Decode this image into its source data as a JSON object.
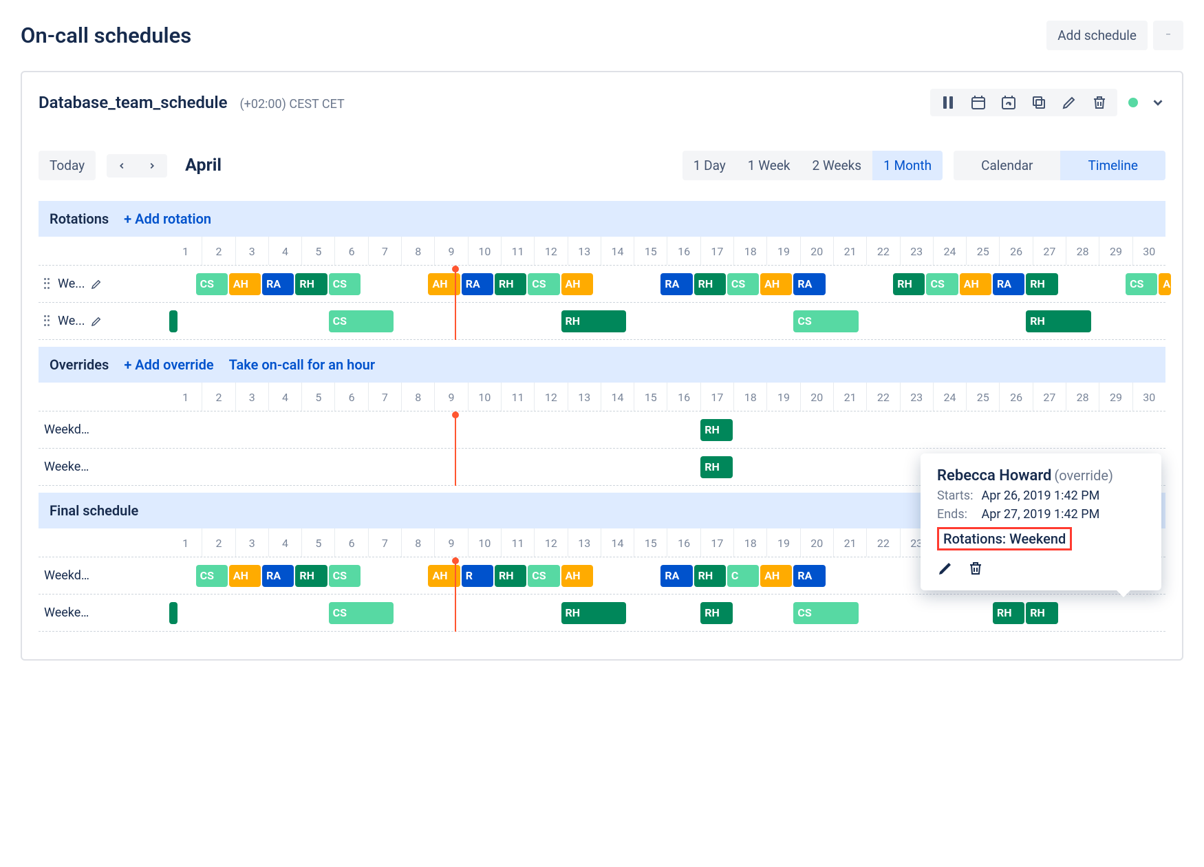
{
  "page_title": "On-call schedules",
  "add_schedule_label": "Add schedule",
  "schedule_name": "Database_team_schedule",
  "timezone": "(+02:00) CEST CET",
  "nav": {
    "today": "Today",
    "month": "April"
  },
  "ranges": {
    "day": "1 Day",
    "week": "1 Week",
    "two_weeks": "2 Weeks",
    "month": "1 Month"
  },
  "view": {
    "calendar": "Calendar",
    "timeline": "Timeline"
  },
  "days": [
    "1",
    "2",
    "3",
    "4",
    "5",
    "6",
    "7",
    "8",
    "9",
    "10",
    "11",
    "12",
    "13",
    "14",
    "15",
    "16",
    "17",
    "18",
    "19",
    "20",
    "21",
    "22",
    "23",
    "24",
    "25",
    "26",
    "27",
    "28",
    "29",
    "30"
  ],
  "now_day_index": 8.6,
  "sections": {
    "rotations": {
      "title": "Rotations",
      "add": "+ Add rotation",
      "rows": [
        {
          "label": "We...",
          "draggable": true,
          "editable": true,
          "blocks": [
            {
              "start": 0.8,
              "span": 1,
              "label": "CS",
              "color": "c-lime"
            },
            {
              "start": 1.8,
              "span": 1,
              "label": "AH",
              "color": "c-orange"
            },
            {
              "start": 2.8,
              "span": 1,
              "label": "RA",
              "color": "c-blue"
            },
            {
              "start": 3.8,
              "span": 1,
              "label": "RH",
              "color": "c-teal"
            },
            {
              "start": 4.8,
              "span": 1,
              "label": "CS",
              "color": "c-lime"
            },
            {
              "start": 7.8,
              "span": 1,
              "label": "AH",
              "color": "c-orange"
            },
            {
              "start": 8.8,
              "span": 1,
              "label": "RA",
              "color": "c-blue"
            },
            {
              "start": 9.8,
              "span": 1,
              "label": "RH",
              "color": "c-teal"
            },
            {
              "start": 10.8,
              "span": 1,
              "label": "CS",
              "color": "c-lime"
            },
            {
              "start": 11.8,
              "span": 1,
              "label": "AH",
              "color": "c-orange"
            },
            {
              "start": 14.8,
              "span": 1,
              "label": "RA",
              "color": "c-blue"
            },
            {
              "start": 15.8,
              "span": 1,
              "label": "RH",
              "color": "c-teal"
            },
            {
              "start": 16.8,
              "span": 1,
              "label": "CS",
              "color": "c-lime"
            },
            {
              "start": 17.8,
              "span": 1,
              "label": "AH",
              "color": "c-orange"
            },
            {
              "start": 18.8,
              "span": 1,
              "label": "RA",
              "color": "c-blue"
            },
            {
              "start": 21.8,
              "span": 1,
              "label": "RH",
              "color": "c-teal"
            },
            {
              "start": 22.8,
              "span": 1,
              "label": "CS",
              "color": "c-lime"
            },
            {
              "start": 23.8,
              "span": 1,
              "label": "AH",
              "color": "c-orange"
            },
            {
              "start": 24.8,
              "span": 1,
              "label": "RA",
              "color": "c-blue"
            },
            {
              "start": 25.8,
              "span": 1,
              "label": "RH",
              "color": "c-teal"
            },
            {
              "start": 28.8,
              "span": 1,
              "label": "CS",
              "color": "c-lime"
            },
            {
              "start": 29.8,
              "span": 0.4,
              "label": "A",
              "color": "c-orange"
            }
          ]
        },
        {
          "label": "We...",
          "draggable": true,
          "editable": true,
          "blocks": [
            {
              "start": 0,
              "span": 0.3,
              "label": "",
              "color": "c-teal"
            },
            {
              "start": 4.8,
              "span": 2,
              "label": "CS",
              "color": "c-lime"
            },
            {
              "start": 11.8,
              "span": 2,
              "label": "RH",
              "color": "c-teal"
            },
            {
              "start": 18.8,
              "span": 2,
              "label": "CS",
              "color": "c-lime"
            },
            {
              "start": 25.8,
              "span": 2,
              "label": "RH",
              "color": "c-teal"
            }
          ]
        }
      ]
    },
    "overrides": {
      "title": "Overrides",
      "add": "+ Add override",
      "take": "Take on-call for an hour",
      "rows": [
        {
          "label": "Weekday's...",
          "blocks": [
            {
              "start": 16,
              "span": 1,
              "label": "RH",
              "color": "c-teal"
            }
          ]
        },
        {
          "label": "Weekend'...",
          "blocks": [
            {
              "start": 16,
              "span": 1,
              "label": "RH",
              "color": "c-teal"
            }
          ]
        }
      ]
    },
    "final": {
      "title": "Final schedule",
      "rows": [
        {
          "label": "Weekday's...",
          "blocks": [
            {
              "start": 0.8,
              "span": 1,
              "label": "CS",
              "color": "c-lime",
              "shadow": true
            },
            {
              "start": 1.8,
              "span": 1,
              "label": "AH",
              "color": "c-orange",
              "shadow": true
            },
            {
              "start": 2.8,
              "span": 1,
              "label": "RA",
              "color": "c-blue",
              "shadow": true
            },
            {
              "start": 3.8,
              "span": 1,
              "label": "RH",
              "color": "c-teal",
              "shadow": true
            },
            {
              "start": 4.8,
              "span": 1,
              "label": "CS",
              "color": "c-lime",
              "shadow": true
            },
            {
              "start": 7.8,
              "span": 1,
              "label": "AH",
              "color": "c-orange",
              "shadow": true
            },
            {
              "start": 8.8,
              "span": 1,
              "label": "R",
              "color": "c-blue"
            },
            {
              "start": 9.8,
              "span": 1,
              "label": "RH",
              "color": "c-teal"
            },
            {
              "start": 10.8,
              "span": 1,
              "label": "CS",
              "color": "c-lime"
            },
            {
              "start": 11.8,
              "span": 1,
              "label": "AH",
              "color": "c-orange"
            },
            {
              "start": 14.8,
              "span": 1,
              "label": "RA",
              "color": "c-blue"
            },
            {
              "start": 15.8,
              "span": 1,
              "label": "RH",
              "color": "c-teal"
            },
            {
              "start": 16.8,
              "span": 1,
              "label": "C",
              "color": "c-lime"
            },
            {
              "start": 17.8,
              "span": 1,
              "label": "AH",
              "color": "c-orange"
            },
            {
              "start": 18.8,
              "span": 1,
              "label": "RA",
              "color": "c-blue"
            }
          ]
        },
        {
          "label": "Weekend'...",
          "blocks": [
            {
              "start": 0,
              "span": 0.3,
              "label": "",
              "color": "c-teal"
            },
            {
              "start": 4.8,
              "span": 2,
              "label": "CS",
              "color": "c-lime",
              "shadow": true
            },
            {
              "start": 11.8,
              "span": 2,
              "label": "RH",
              "color": "c-teal"
            },
            {
              "start": 16,
              "span": 1,
              "label": "RH",
              "color": "c-teal"
            },
            {
              "start": 18.8,
              "span": 2,
              "label": "CS",
              "color": "c-lime"
            },
            {
              "start": 24.8,
              "span": 1,
              "label": "RH",
              "color": "c-teal"
            },
            {
              "start": 25.8,
              "span": 1,
              "label": "RH",
              "color": "c-teal"
            }
          ]
        }
      ]
    }
  },
  "popover": {
    "name": "Rebecca Howard",
    "suffix": "(override)",
    "starts_label": "Starts:",
    "starts_value": "Apr 26, 2019 1:42 PM",
    "ends_label": "Ends:",
    "ends_value": "Apr 27, 2019 1:42 PM",
    "rotations_text": "Rotations: Weekend"
  }
}
